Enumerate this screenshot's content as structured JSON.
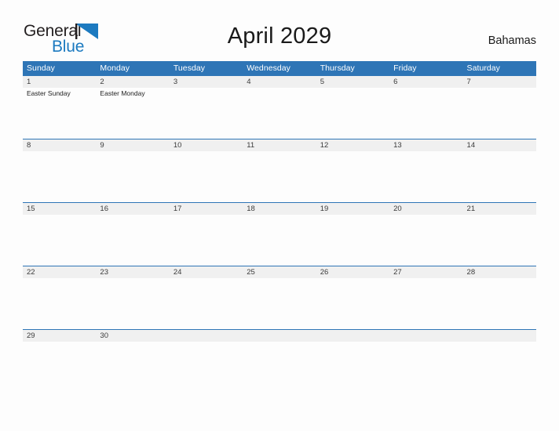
{
  "brand": {
    "name_part1": "General",
    "name_part2": "Blue",
    "accent_color": "#1c7ac0",
    "flag_icon": "blue-triangle-flag"
  },
  "header": {
    "title": "April 2029",
    "country": "Bahamas"
  },
  "calendar": {
    "header_bg": "#2e75b6",
    "daynum_band_bg": "#f0f0f0",
    "weekdays": [
      "Sunday",
      "Monday",
      "Tuesday",
      "Wednesday",
      "Thursday",
      "Friday",
      "Saturday"
    ],
    "weeks": [
      {
        "days": [
          {
            "num": "1",
            "events": [
              "Easter Sunday"
            ]
          },
          {
            "num": "2",
            "events": [
              "Easter Monday"
            ]
          },
          {
            "num": "3",
            "events": []
          },
          {
            "num": "4",
            "events": []
          },
          {
            "num": "5",
            "events": []
          },
          {
            "num": "6",
            "events": []
          },
          {
            "num": "7",
            "events": []
          }
        ]
      },
      {
        "days": [
          {
            "num": "8",
            "events": []
          },
          {
            "num": "9",
            "events": []
          },
          {
            "num": "10",
            "events": []
          },
          {
            "num": "11",
            "events": []
          },
          {
            "num": "12",
            "events": []
          },
          {
            "num": "13",
            "events": []
          },
          {
            "num": "14",
            "events": []
          }
        ]
      },
      {
        "days": [
          {
            "num": "15",
            "events": []
          },
          {
            "num": "16",
            "events": []
          },
          {
            "num": "17",
            "events": []
          },
          {
            "num": "18",
            "events": []
          },
          {
            "num": "19",
            "events": []
          },
          {
            "num": "20",
            "events": []
          },
          {
            "num": "21",
            "events": []
          }
        ]
      },
      {
        "days": [
          {
            "num": "22",
            "events": []
          },
          {
            "num": "23",
            "events": []
          },
          {
            "num": "24",
            "events": []
          },
          {
            "num": "25",
            "events": []
          },
          {
            "num": "26",
            "events": []
          },
          {
            "num": "27",
            "events": []
          },
          {
            "num": "28",
            "events": []
          }
        ]
      },
      {
        "days": [
          {
            "num": "29",
            "events": []
          },
          {
            "num": "30",
            "events": []
          },
          {
            "num": "",
            "events": []
          },
          {
            "num": "",
            "events": []
          },
          {
            "num": "",
            "events": []
          },
          {
            "num": "",
            "events": []
          },
          {
            "num": "",
            "events": []
          }
        ]
      }
    ]
  }
}
